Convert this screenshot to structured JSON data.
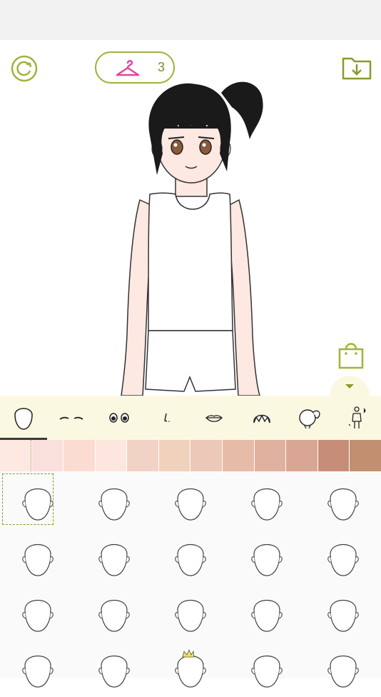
{
  "toolbar": {
    "reset_icon": "rotate-reset-icon",
    "wardrobe_icon": "hanger-icon",
    "wardrobe_count": "3",
    "save_icon": "folder-download-icon",
    "shop_icon": "shopping-bag-icon",
    "collapse_icon": "chevron-down-icon"
  },
  "colors": {
    "accent": "#a4b13a",
    "hanger": "#e0479e",
    "panel": "#fbf8e2",
    "skin": "#fde8e2"
  },
  "categories": [
    {
      "name": "face",
      "icon": "face-shape-icon"
    },
    {
      "name": "eyebrows",
      "icon": "eyebrows-icon"
    },
    {
      "name": "eyes",
      "icon": "eyes-icon"
    },
    {
      "name": "nose",
      "icon": "nose-icon"
    },
    {
      "name": "mouth",
      "icon": "lips-icon"
    },
    {
      "name": "hair-front",
      "icon": "bangs-icon"
    },
    {
      "name": "hair-back",
      "icon": "ponytail-icon"
    },
    {
      "name": "outfit",
      "icon": "outfit-icon"
    }
  ],
  "active_category": "face",
  "skin_swatches": [
    "#fde8e2",
    "#f9e0dc",
    "#fcdcd2",
    "#fde6de",
    "#f3d2c6",
    "#f0d2bc",
    "#ebc8b8",
    "#e6bca8",
    "#dfb19e",
    "#d8a692",
    "#c68e79",
    "#c09070"
  ],
  "selected_swatch": 0,
  "face_items_count": 20,
  "selected_face": 0
}
